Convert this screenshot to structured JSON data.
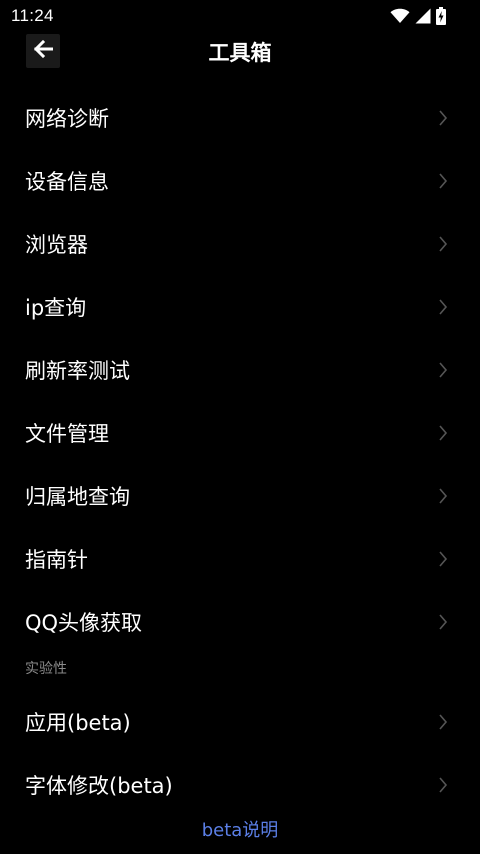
{
  "status_bar": {
    "time": "11:24",
    "icons": [
      "wifi-icon",
      "cellular-signal-icon",
      "battery-charging-icon"
    ]
  },
  "app_bar": {
    "title": "工具箱",
    "back_icon": "arrow-left-icon"
  },
  "menu": {
    "items": [
      {
        "label": "网络诊断"
      },
      {
        "label": "设备信息"
      },
      {
        "label": "浏览器"
      },
      {
        "label": "ip查询"
      },
      {
        "label": "刷新率测试"
      },
      {
        "label": "文件管理"
      },
      {
        "label": "归属地查询"
      },
      {
        "label": "指南针"
      },
      {
        "label": "QQ头像获取"
      }
    ],
    "chevron_icon": "chevron-right-icon"
  },
  "experimental": {
    "header": "实验性",
    "items": [
      {
        "label": "应用(beta)"
      },
      {
        "label": "字体修改(beta)"
      }
    ]
  },
  "footer": {
    "link_label": "beta说明"
  },
  "colors": {
    "background": "#000000",
    "text": "#ffffff",
    "chevron": "#555555",
    "section_header": "#8a8a8a",
    "link": "#5b7fe6"
  }
}
